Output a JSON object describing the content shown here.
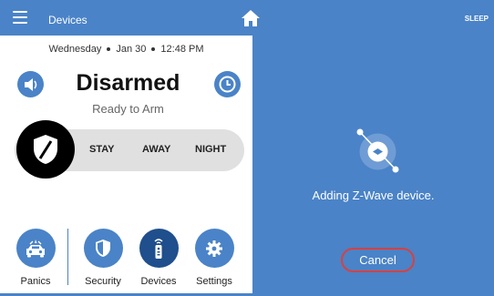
{
  "header": {
    "title": "Devices",
    "sleep_label": "SLEEP",
    "menu_icon": "hamburger-menu-icon",
    "home_icon": "home-icon",
    "sleep_icon": "moon-icon"
  },
  "left_panel": {
    "date": "Wednesday",
    "day": "Jan 30",
    "time": "12:48 PM",
    "status": "Disarmed",
    "substatus": "Ready to Arm",
    "arm_modes": [
      "STAY",
      "AWAY",
      "NIGHT"
    ],
    "nav": [
      {
        "label": "Panics",
        "icon": "police-car-icon"
      },
      {
        "label": "Security",
        "icon": "shield-icon"
      },
      {
        "label": "Devices",
        "icon": "remote-icon"
      },
      {
        "label": "Settings",
        "icon": "gear-icon"
      }
    ]
  },
  "right_panel": {
    "message": "Adding Z-Wave device.",
    "cancel_label": "Cancel",
    "icon": "zwave-icon"
  },
  "colors": {
    "primary": "#4a83c7",
    "cancel_border": "#d94040",
    "arm_bar": "#e0e0e0"
  }
}
